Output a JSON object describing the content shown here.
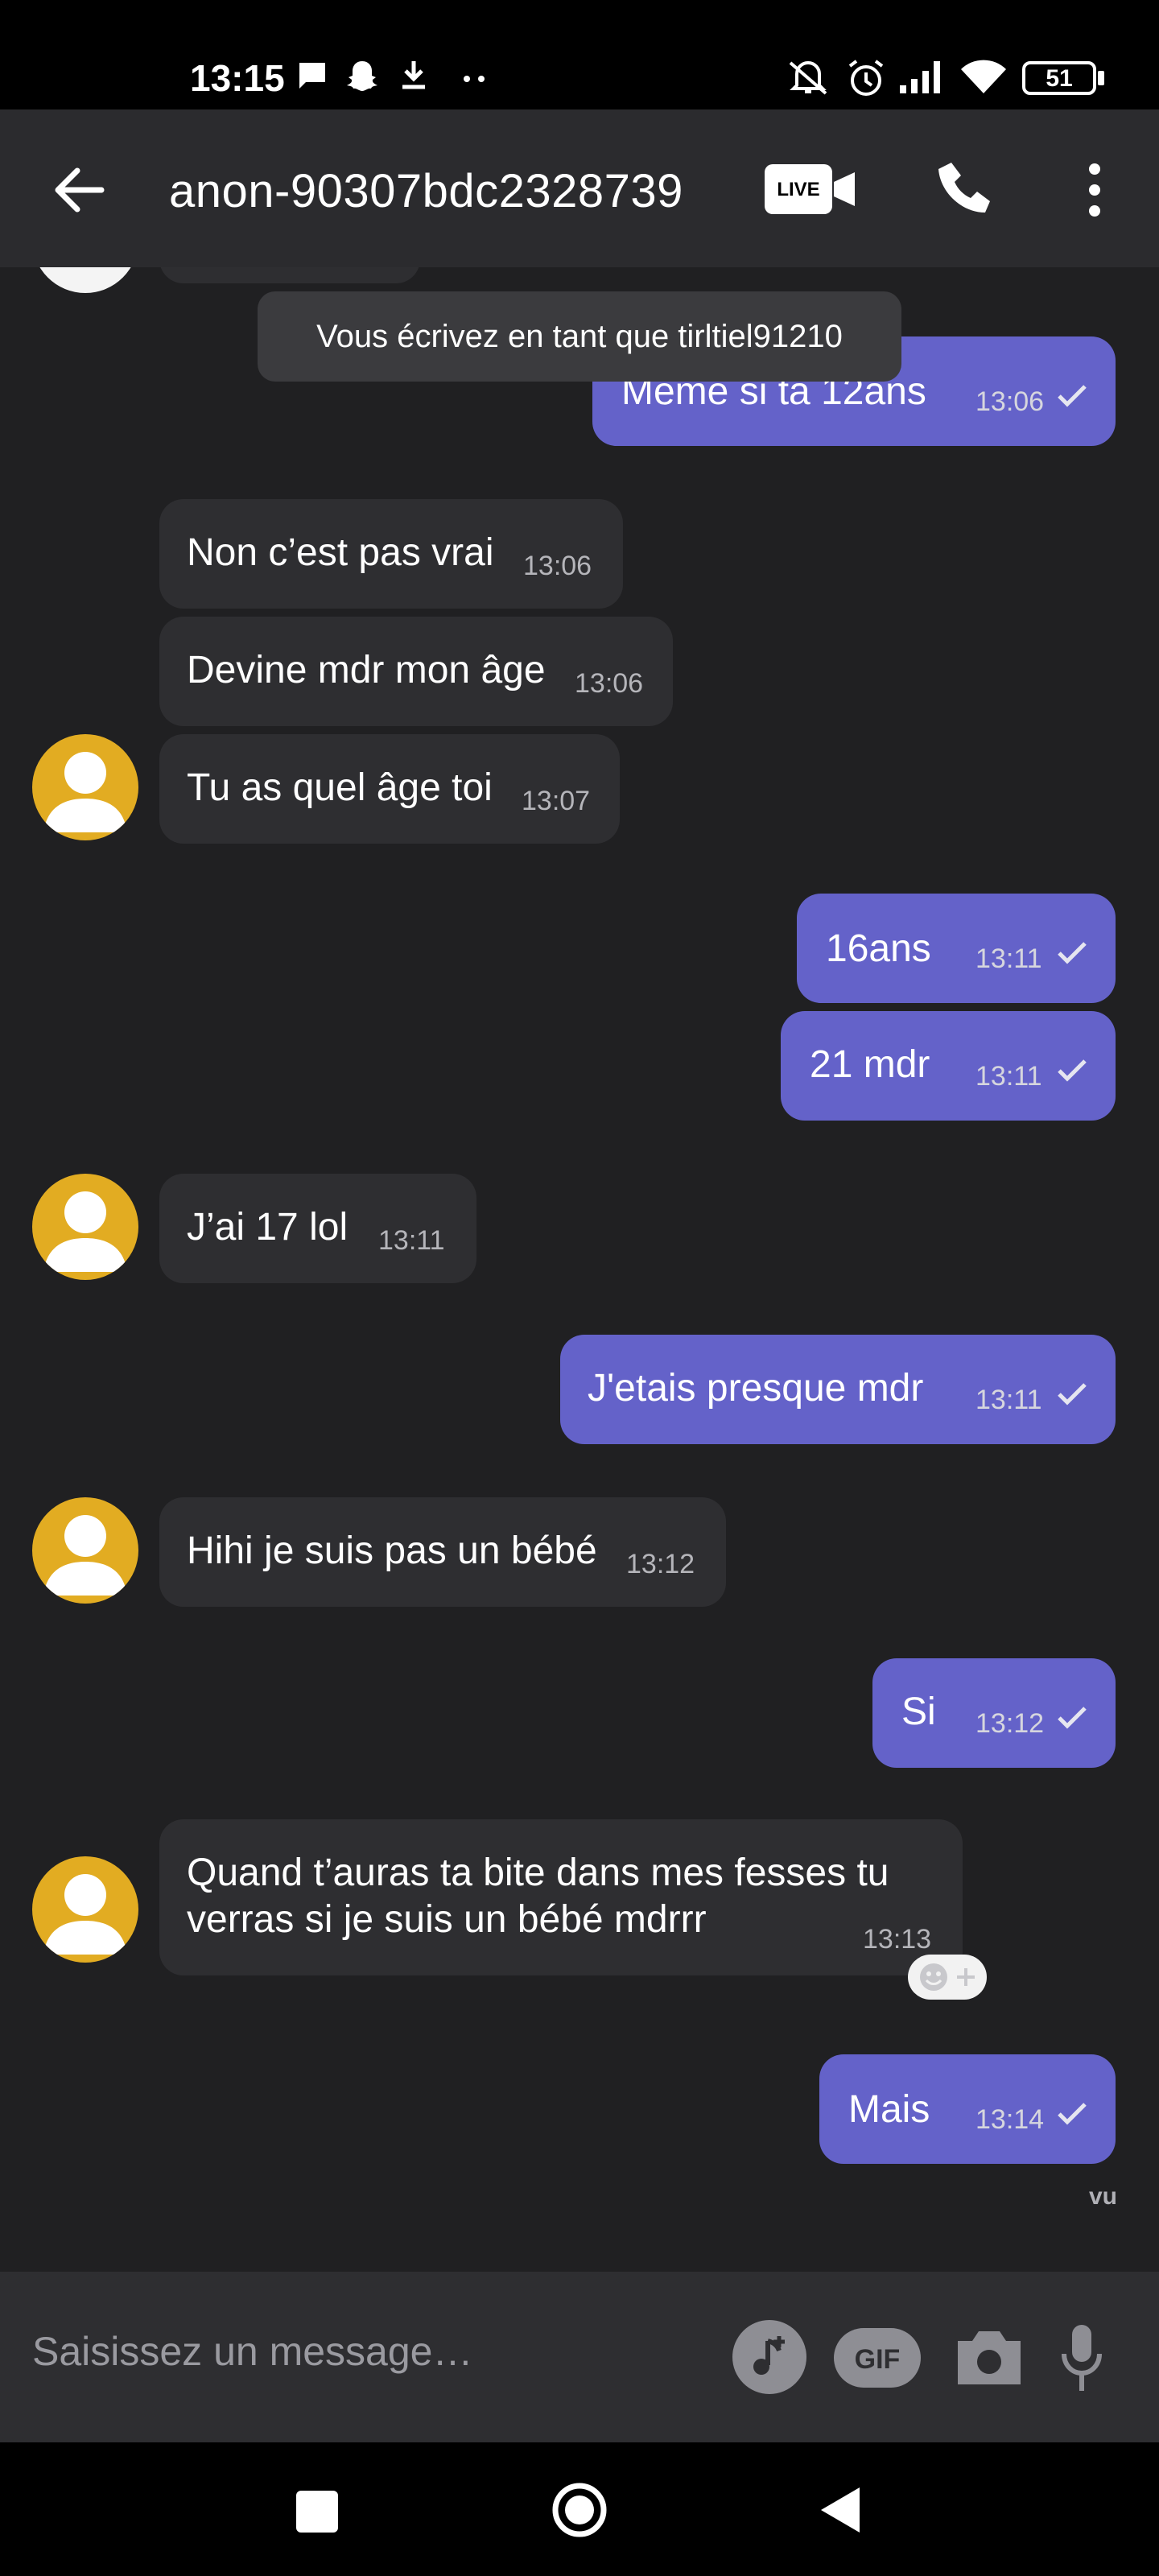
{
  "status_bar": {
    "time": "13:15",
    "battery": "51",
    "icons": [
      "message-icon",
      "snapchat-icon",
      "download-icon",
      "more-dots-icon",
      "mute-icon",
      "alarm-icon",
      "signal-icon",
      "wifi-icon",
      "battery-icon"
    ]
  },
  "header": {
    "title": "anon-90307bdc2328739",
    "live_label": "LIVE"
  },
  "chat": {
    "toast": "Vous écrivez en tant que tirltiel91210",
    "messages": [
      {
        "dir": "out",
        "text": "Même si ta 12ans",
        "time": "13:06"
      },
      {
        "dir": "in",
        "text": "Non c’est pas vrai",
        "time": "13:06"
      },
      {
        "dir": "in",
        "text": "Devine mdr mon âge",
        "time": "13:06"
      },
      {
        "dir": "in",
        "text": "Tu as quel âge toi",
        "time": "13:07"
      },
      {
        "dir": "out",
        "text": "16ans",
        "time": "13:11"
      },
      {
        "dir": "out",
        "text": "21 mdr",
        "time": "13:11"
      },
      {
        "dir": "in",
        "text": "J’ai 17 lol",
        "time": "13:11"
      },
      {
        "dir": "out",
        "text": "J'etais presque mdr",
        "time": "13:11"
      },
      {
        "dir": "in",
        "text": "Hihi je suis pas un bébé",
        "time": "13:12"
      },
      {
        "dir": "out",
        "text": "Si",
        "time": "13:12"
      },
      {
        "dir": "in",
        "line1": "Quand t’auras ta bite dans mes fesses tu",
        "line2": "verras si je suis un bébé mdrrr",
        "time": "13:13"
      },
      {
        "dir": "out",
        "text": "Mais",
        "time": "13:14"
      }
    ],
    "seen": "vu"
  },
  "composer": {
    "placeholder": "Saisissez un message…",
    "gif_label": "GIF"
  },
  "colors": {
    "outgoing_bubble": "#6462c9",
    "incoming_bubble": "#2e2e31",
    "background": "#202022",
    "avatar": "#e2ac22"
  }
}
